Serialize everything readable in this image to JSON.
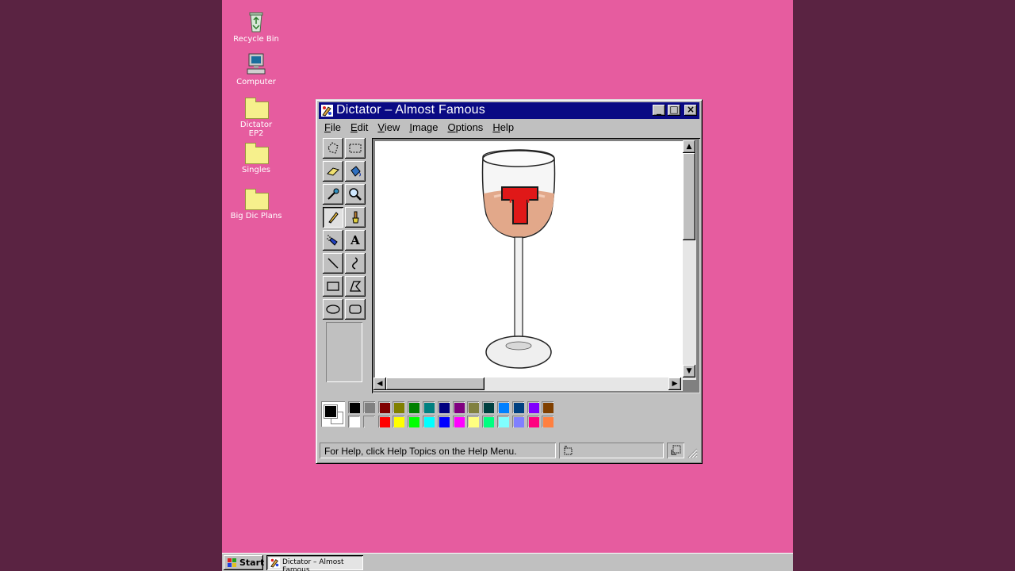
{
  "desktop": {
    "icons": [
      {
        "label_lines": [
          "Recycle Bin"
        ],
        "icon": "recycle-bin-icon"
      },
      {
        "label_lines": [
          "Computer"
        ],
        "icon": "computer-icon"
      },
      {
        "label_lines": [
          "Dictator",
          "EP2"
        ],
        "icon": "folder-icon"
      },
      {
        "label_lines": [
          "Singles"
        ],
        "icon": "folder-icon"
      },
      {
        "label_lines": [
          "Big Dic Plans"
        ],
        "icon": "folder-icon"
      }
    ]
  },
  "window": {
    "title": "Dictator – Almost Famous",
    "controls": {
      "minimize": "_",
      "maximize": "□",
      "close": "×"
    },
    "menu": [
      {
        "accel": "F",
        "rest": "ile"
      },
      {
        "accel": "E",
        "rest": "dit"
      },
      {
        "accel": "V",
        "rest": "iew"
      },
      {
        "accel": "I",
        "rest": "mage"
      },
      {
        "accel": "O",
        "rest": "ptions"
      },
      {
        "accel": "H",
        "rest": "elp"
      }
    ],
    "tools": [
      "free-form-select-icon",
      "rectangle-select-icon",
      "eraser-icon",
      "fill-bucket-icon",
      "color-picker-icon",
      "magnifier-icon",
      "pencil-icon",
      "brush-icon",
      "airbrush-icon",
      "text-icon",
      "line-icon",
      "curve-icon",
      "rectangle-icon",
      "polygon-icon",
      "ellipse-icon",
      "rounded-rectangle-icon"
    ],
    "active_tool": "pencil-icon",
    "text_tool_glyph": "A",
    "canvas_letter": "T",
    "palette": {
      "foreground": "#000000",
      "background": "#ffffff",
      "row1": [
        "#000000",
        "#808080",
        "#800000",
        "#808000",
        "#008000",
        "#008080",
        "#000080",
        "#800080",
        "#808040",
        "#004040",
        "#0080ff",
        "#004080",
        "#8000ff",
        "#804000"
      ],
      "row2": [
        "#ffffff",
        "#c0c0c0",
        "#ff0000",
        "#ffff00",
        "#00ff00",
        "#00ffff",
        "#0000ff",
        "#ff00ff",
        "#ffff80",
        "#00ff80",
        "#80ffff",
        "#8080ff",
        "#ff0080",
        "#ff8040"
      ]
    },
    "status": "For Help, click Help Topics on the Help Menu."
  },
  "taskbar": {
    "start_label": "Start",
    "task_label": "Dictator – Almost Famous"
  }
}
